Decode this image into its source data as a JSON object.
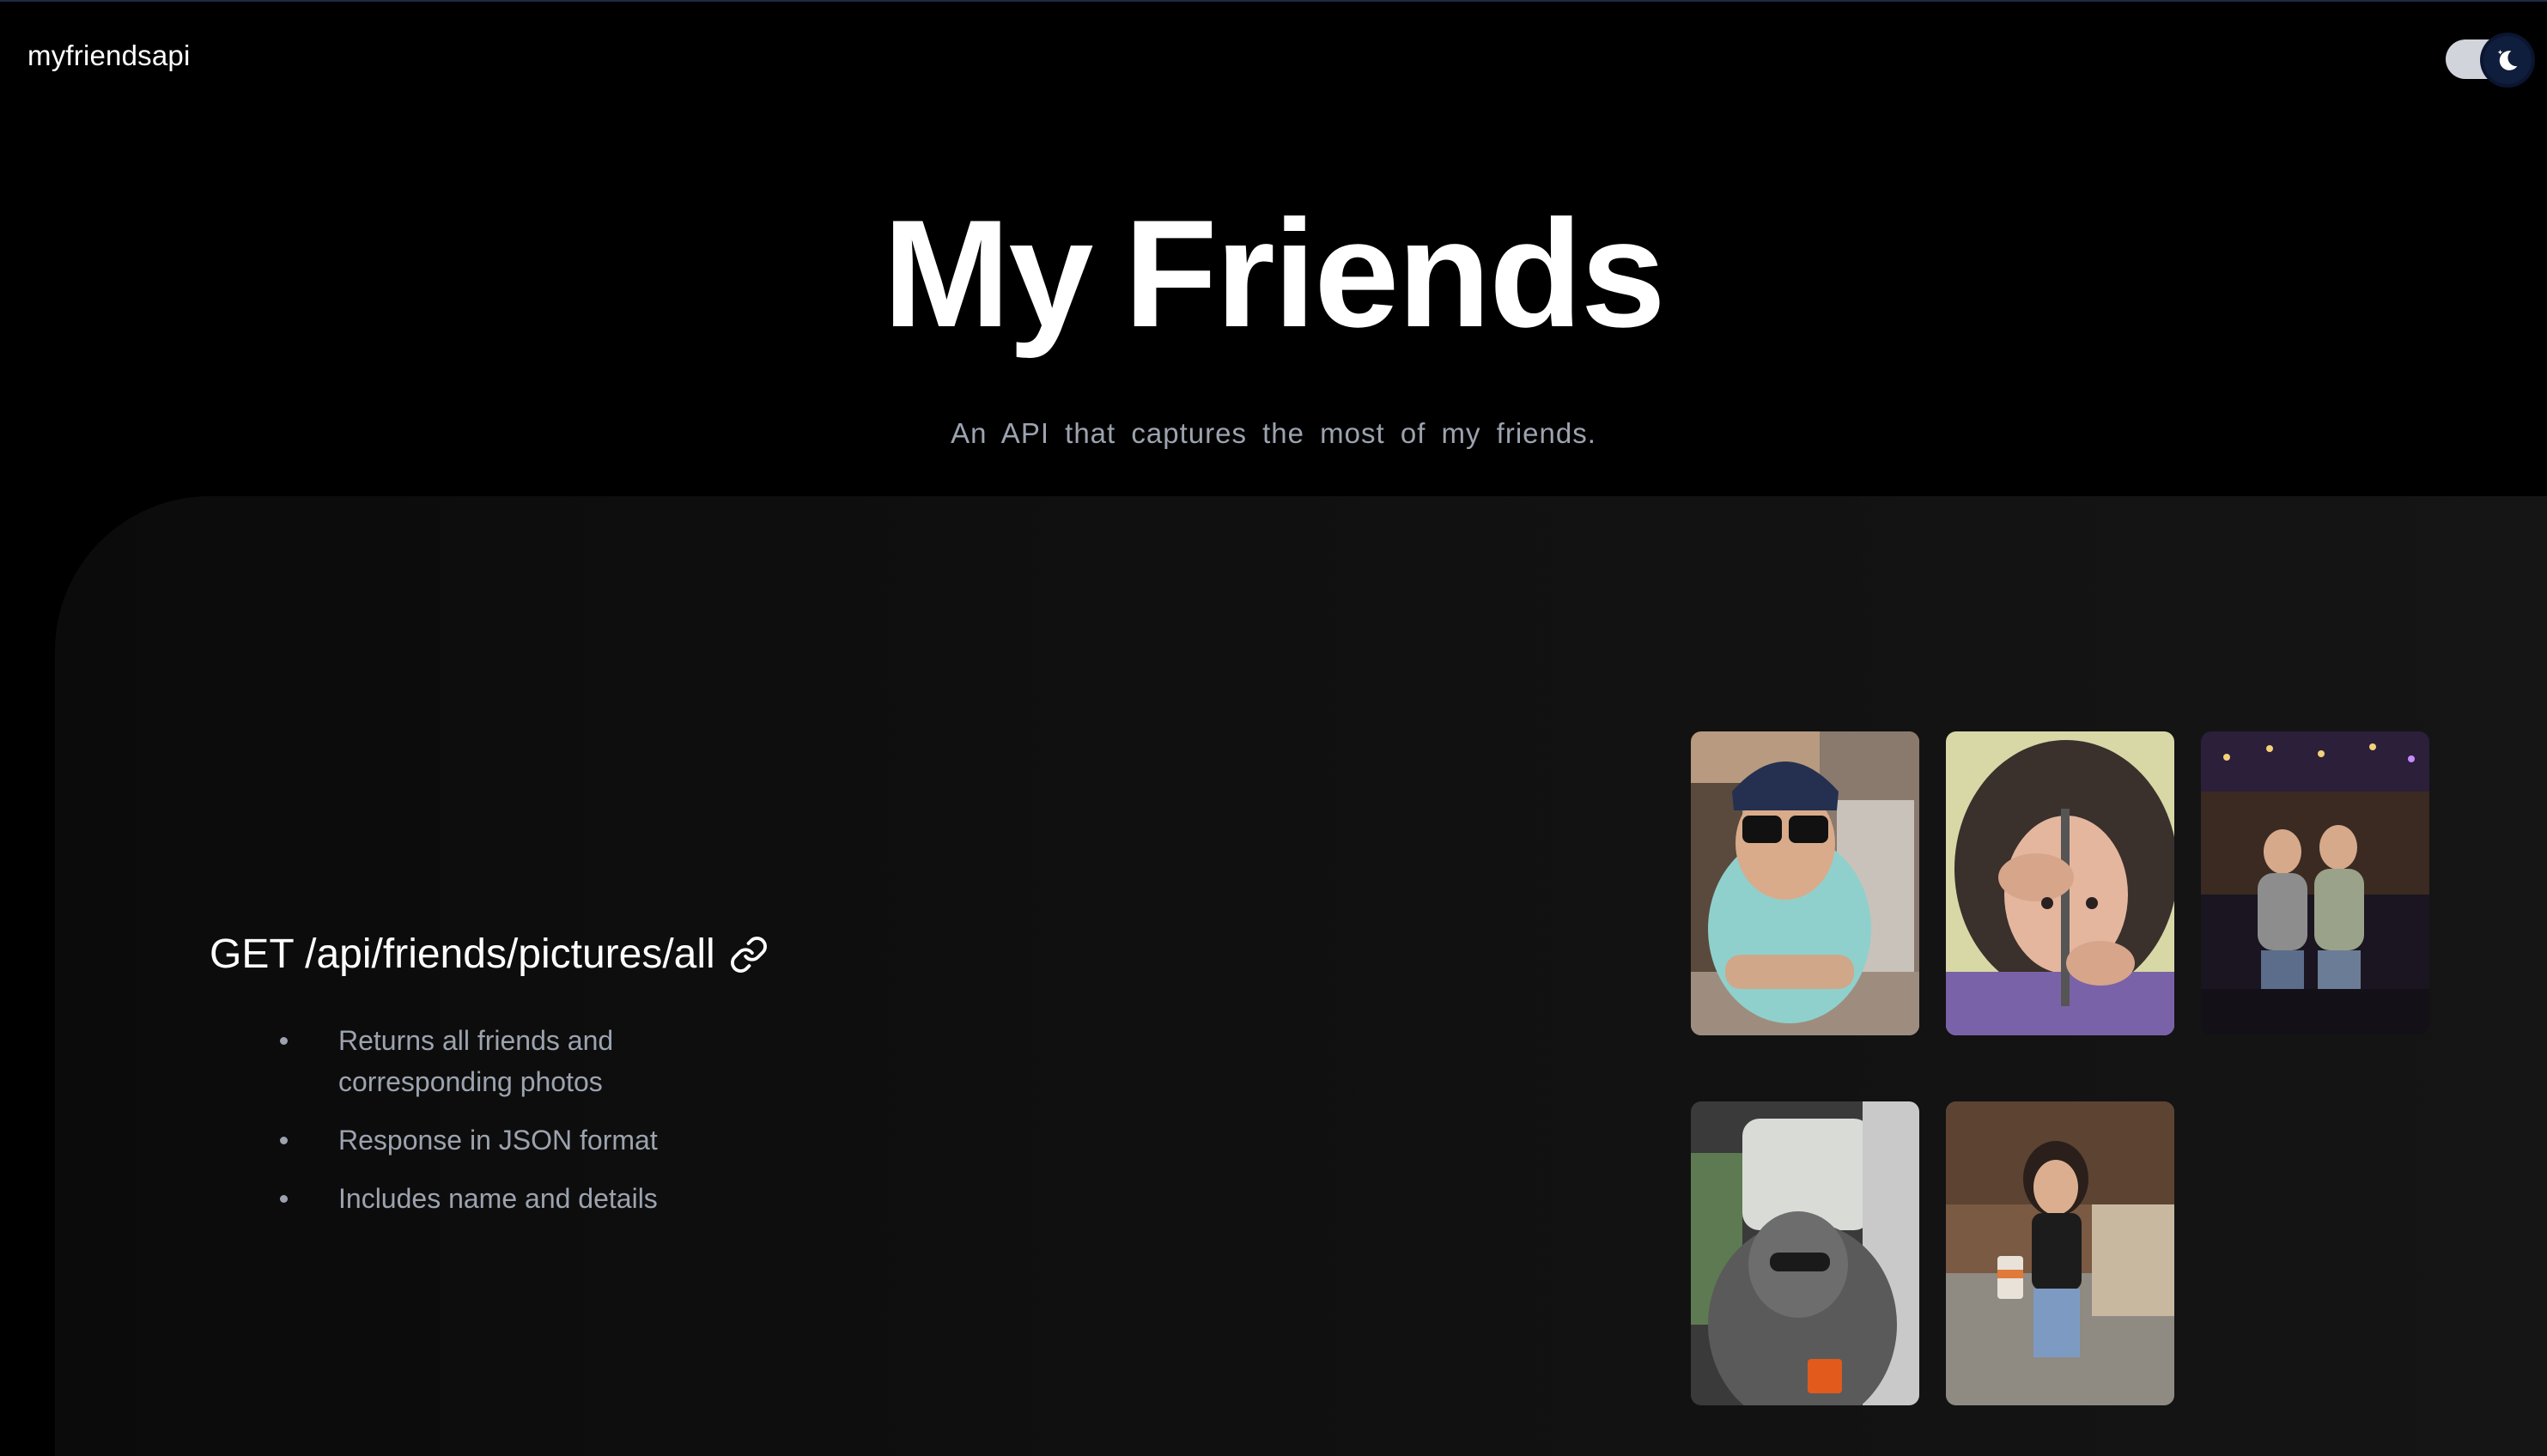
{
  "header": {
    "brand": "myfriendsapi",
    "theme_toggle": {
      "mode": "dark",
      "icon": "moon-icon"
    }
  },
  "hero": {
    "title": "My Friends",
    "subtitle": "An API that captures the most of my friends."
  },
  "endpoint": {
    "label": "GET /api/friends/pictures/all",
    "icon": "link-icon",
    "features": [
      "Returns all friends and corresponding photos",
      "Response in JSON format",
      "Includes name and details"
    ]
  },
  "gallery": {
    "photos": [
      {
        "name": "friend-photo-1"
      },
      {
        "name": "friend-photo-2"
      },
      {
        "name": "friend-photo-3"
      },
      {
        "name": "friend-photo-4"
      },
      {
        "name": "friend-photo-5"
      }
    ]
  },
  "colors": {
    "background": "#000000",
    "panel": "#111111",
    "muted_text": "#9ca3af",
    "toggle_knob": "#0f1e3d"
  }
}
